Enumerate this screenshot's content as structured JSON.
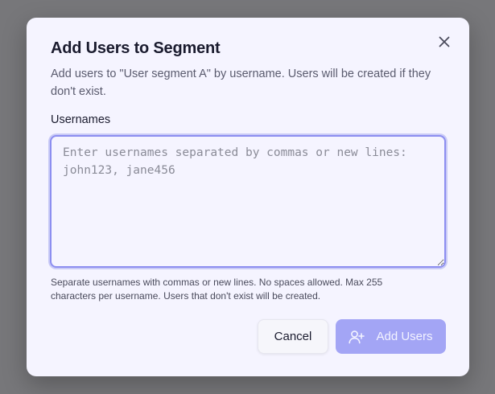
{
  "modal": {
    "title": "Add Users to Segment",
    "description": "Add users to \"User segment A\" by username. Users will be created if they don't exist.",
    "close_icon": "close-icon"
  },
  "usernames_field": {
    "label": "Usernames",
    "value": "",
    "placeholder": "Enter usernames separated by commas or new lines: john123, jane456",
    "helper_text": "Separate usernames with commas or new lines. No spaces allowed. Max 255 characters per username. Users that don't exist will be created."
  },
  "actions": {
    "cancel_label": "Cancel",
    "add_label": "Add Users",
    "add_icon": "user-plus-icon",
    "add_enabled": false
  },
  "colors": {
    "overlay": "#77777a",
    "modal_background": "#f5f4ff",
    "accent_border": "#8c8ef0",
    "primary_button_disabled": "#a3a5f5"
  }
}
